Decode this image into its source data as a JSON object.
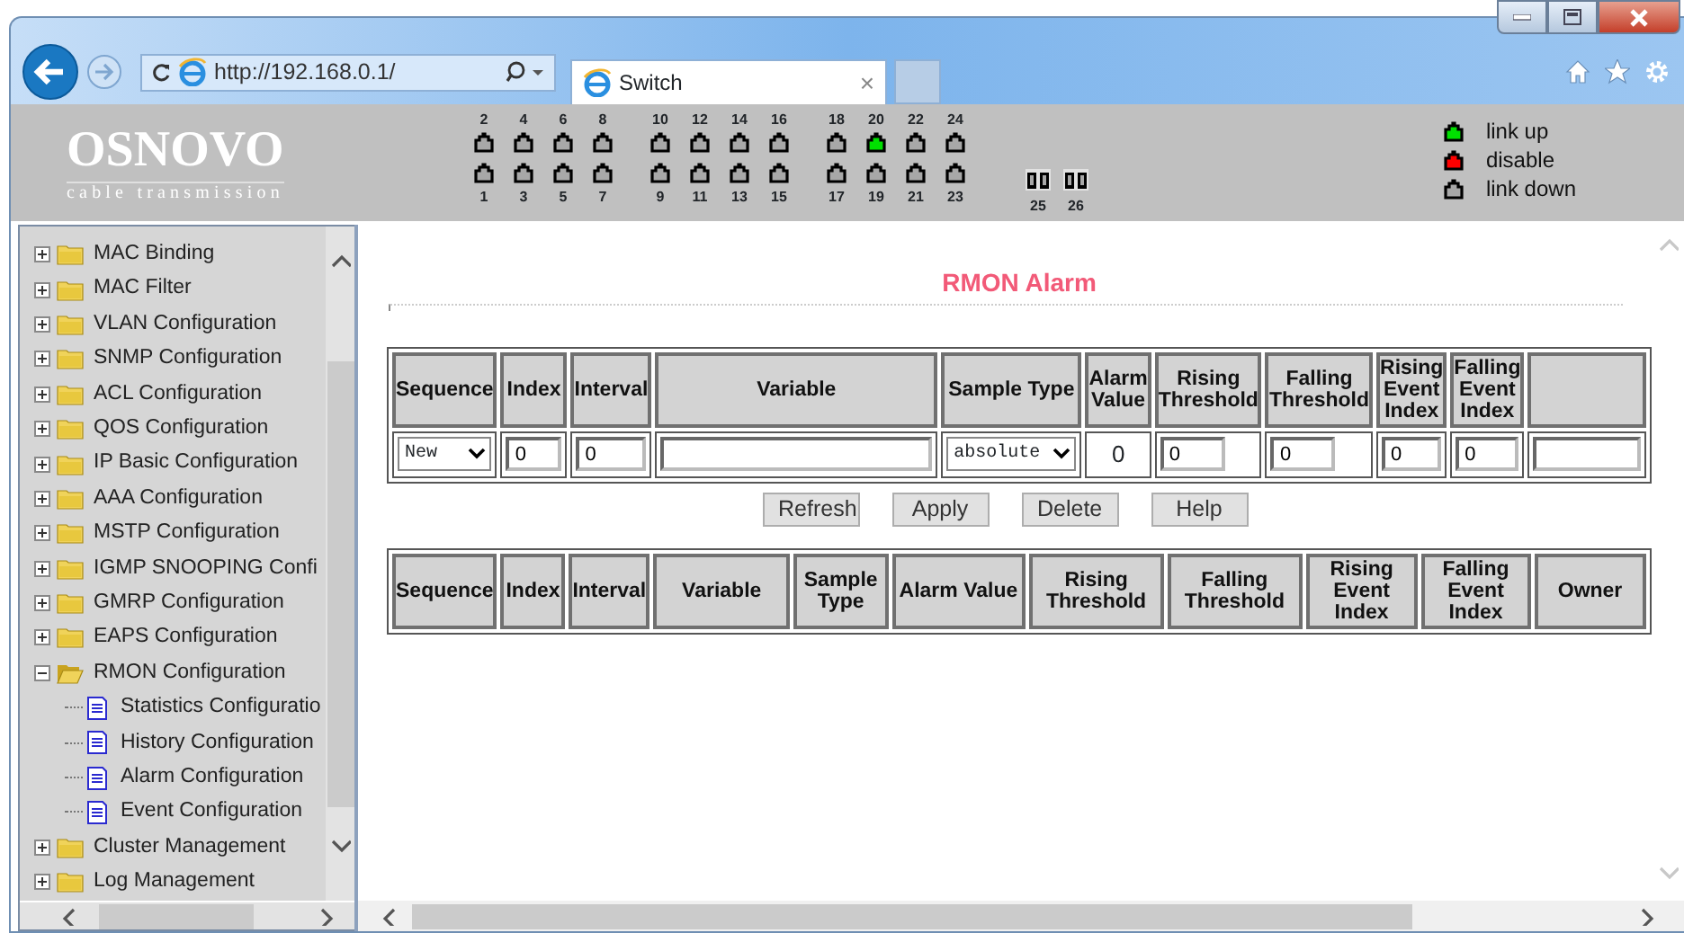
{
  "browser": {
    "address": "http://192.168.0.1/",
    "tab_title": "Switch",
    "tab_close": "×"
  },
  "header": {
    "logo": "OSNOVO",
    "tagline": "cable transmission",
    "port_groups": [
      [
        {
          "top": {
            "label": "2",
            "color": "#a8a8a8"
          },
          "bottom": {
            "label": "1",
            "color": "#a8a8a8"
          }
        },
        {
          "top": {
            "label": "4",
            "color": "#a8a8a8"
          },
          "bottom": {
            "label": "3",
            "color": "#a8a8a8"
          }
        },
        {
          "top": {
            "label": "6",
            "color": "#a8a8a8"
          },
          "bottom": {
            "label": "5",
            "color": "#a8a8a8"
          }
        },
        {
          "top": {
            "label": "8",
            "color": "#a8a8a8"
          },
          "bottom": {
            "label": "7",
            "color": "#a8a8a8"
          }
        }
      ],
      [
        {
          "top": {
            "label": "10",
            "color": "#a8a8a8"
          },
          "bottom": {
            "label": "9",
            "color": "#a8a8a8"
          }
        },
        {
          "top": {
            "label": "12",
            "color": "#a8a8a8"
          },
          "bottom": {
            "label": "11",
            "color": "#a8a8a8"
          }
        },
        {
          "top": {
            "label": "14",
            "color": "#a8a8a8"
          },
          "bottom": {
            "label": "13",
            "color": "#a8a8a8"
          }
        },
        {
          "top": {
            "label": "16",
            "color": "#a8a8a8"
          },
          "bottom": {
            "label": "15",
            "color": "#a8a8a8"
          }
        }
      ],
      [
        {
          "top": {
            "label": "18",
            "color": "#a8a8a8"
          },
          "bottom": {
            "label": "17",
            "color": "#a8a8a8"
          }
        },
        {
          "top": {
            "label": "20",
            "color": "#00e000"
          },
          "bottom": {
            "label": "19",
            "color": "#a8a8a8"
          }
        },
        {
          "top": {
            "label": "22",
            "color": "#a8a8a8"
          },
          "bottom": {
            "label": "21",
            "color": "#a8a8a8"
          }
        },
        {
          "top": {
            "label": "24",
            "color": "#a8a8a8"
          },
          "bottom": {
            "label": "23",
            "color": "#a8a8a8"
          }
        }
      ]
    ],
    "sfp_ports": [
      {
        "label": "25"
      },
      {
        "label": "26"
      }
    ],
    "legend": [
      {
        "color": "#00e000",
        "label": "link up"
      },
      {
        "color": "#ff0000",
        "label": "disable"
      },
      {
        "color": "#a8a8a8",
        "label": "link down"
      }
    ]
  },
  "sidebar": {
    "items": [
      {
        "label": "MAC Binding",
        "expanded": false
      },
      {
        "label": "MAC Filter",
        "expanded": false
      },
      {
        "label": "VLAN Configuration",
        "expanded": false
      },
      {
        "label": "SNMP Configuration",
        "expanded": false
      },
      {
        "label": "ACL Configuration",
        "expanded": false
      },
      {
        "label": "QOS Configuration",
        "expanded": false
      },
      {
        "label": "IP Basic Configuration",
        "expanded": false
      },
      {
        "label": "AAA Configuration",
        "expanded": false
      },
      {
        "label": "MSTP Configuration",
        "expanded": false
      },
      {
        "label": "IGMP SNOOPING Confi",
        "expanded": false
      },
      {
        "label": "GMRP Configuration",
        "expanded": false
      },
      {
        "label": "EAPS Configuration",
        "expanded": false
      },
      {
        "label": "RMON Configuration",
        "expanded": true,
        "children": [
          {
            "label": "Statistics Configuratio"
          },
          {
            "label": "History Configuration"
          },
          {
            "label": "Alarm Configuration"
          },
          {
            "label": "Event Configuration"
          }
        ]
      },
      {
        "label": "Cluster Management",
        "expanded": false
      },
      {
        "label": "Log Management",
        "expanded": false
      }
    ]
  },
  "content": {
    "title": "RMON Alarm",
    "form_columns": [
      {
        "label": "Sequence",
        "cell": {
          "kind": "select",
          "value": "New"
        }
      },
      {
        "label": "Index",
        "cell": {
          "kind": "input",
          "value": "0"
        }
      },
      {
        "label": "Interval",
        "cell": {
          "kind": "input",
          "value": "0"
        }
      },
      {
        "label": "Variable",
        "cell": {
          "kind": "input"
        }
      },
      {
        "label": "Sample Type",
        "cell": {
          "kind": "select",
          "value": "absolute"
        }
      },
      {
        "label": "Alarm Value",
        "cell": {
          "kind": "text",
          "value": "0"
        }
      },
      {
        "label": "Rising Threshold",
        "cell": {
          "kind": "short-input",
          "value": "0"
        }
      },
      {
        "label": "Falling Threshold",
        "cell": {
          "kind": "short-input",
          "value": "0"
        }
      },
      {
        "label": "Rising Event Index",
        "cell": {
          "kind": "input",
          "value": "0"
        }
      },
      {
        "label": "Falling Event Index",
        "cell": {
          "kind": "input",
          "value": "0"
        }
      },
      {
        "cell": {
          "kind": "input"
        }
      }
    ],
    "buttons": [
      "Refresh",
      "Apply",
      "Delete",
      "Help"
    ],
    "list_columns": [
      "Sequence",
      "Index",
      "Interval",
      "Variable",
      "Sample Type",
      "Alarm Value",
      "Rising Threshold",
      "Falling Threshold",
      "Rising Event Index",
      "Falling Event Index",
      "Owner"
    ]
  }
}
